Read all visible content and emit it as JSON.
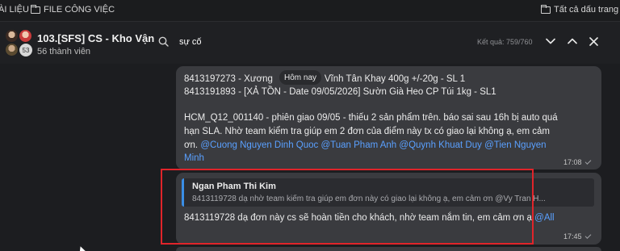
{
  "bookmarks": {
    "left_partial": "ÀI LIỆU",
    "left_folder": "FILE CÔNG VIỆC",
    "right_folder": "Tất cả dấu trang"
  },
  "conversation": {
    "name": "103.[SFS] CS - Kho Vận",
    "members": "56 thành viên",
    "avatar_extra_count": "53"
  },
  "search": {
    "query": "sự cố",
    "result_label": "Kết quả: 759/760"
  },
  "date_pill": "Hôm nay",
  "message1": {
    "line1_a": "8413197273 - Xương",
    "line1_b": "Vĩnh Tân Khay 400g +/-20g - SL 1",
    "line2": "8413191893 - [XẢ TỒN - Date 09/05/2026] Sườn Già Heo CP Túi 1kg - SL1",
    "line3": "HCM_Q12_001140 - phiên giao 09/05 - thiếu 2 sản phẩm trên. báo sai sau 16h bị auto quá",
    "line4": "hạn SLA. Nhờ team kiểm tra giúp em 2 đơn của điểm này tx có giao lại không ạ, em cảm",
    "line5_a": "ơn.",
    "mention1": "@Cuong Nguyen Dinh Quoc",
    "mention2": "@Tuan Pham Anh",
    "mention3": "@Quynh Khuat Duy",
    "mention4_a": "@Tien Nguyen",
    "mention4_b": "Minh",
    "time": "17:08"
  },
  "message2": {
    "quote_author": "Ngan Pham Thi Kim",
    "quote_text": "8413119728 dạ nhờ team kiểm tra giúp em đơn này có giao lại không ạ, em cảm ơn @Vy Tran H...",
    "text": "8413119728  dạ đơn này cs sẽ hoàn tiền cho khách, nhờ team nắm tin, em cảm ơn ạ",
    "mention": "@All",
    "time": "17:45"
  },
  "colors": {
    "mention": "#5aa0ff",
    "highlight_box": "#e0242a",
    "bubble": "#3a3b3f",
    "background": "#1c1d20"
  }
}
